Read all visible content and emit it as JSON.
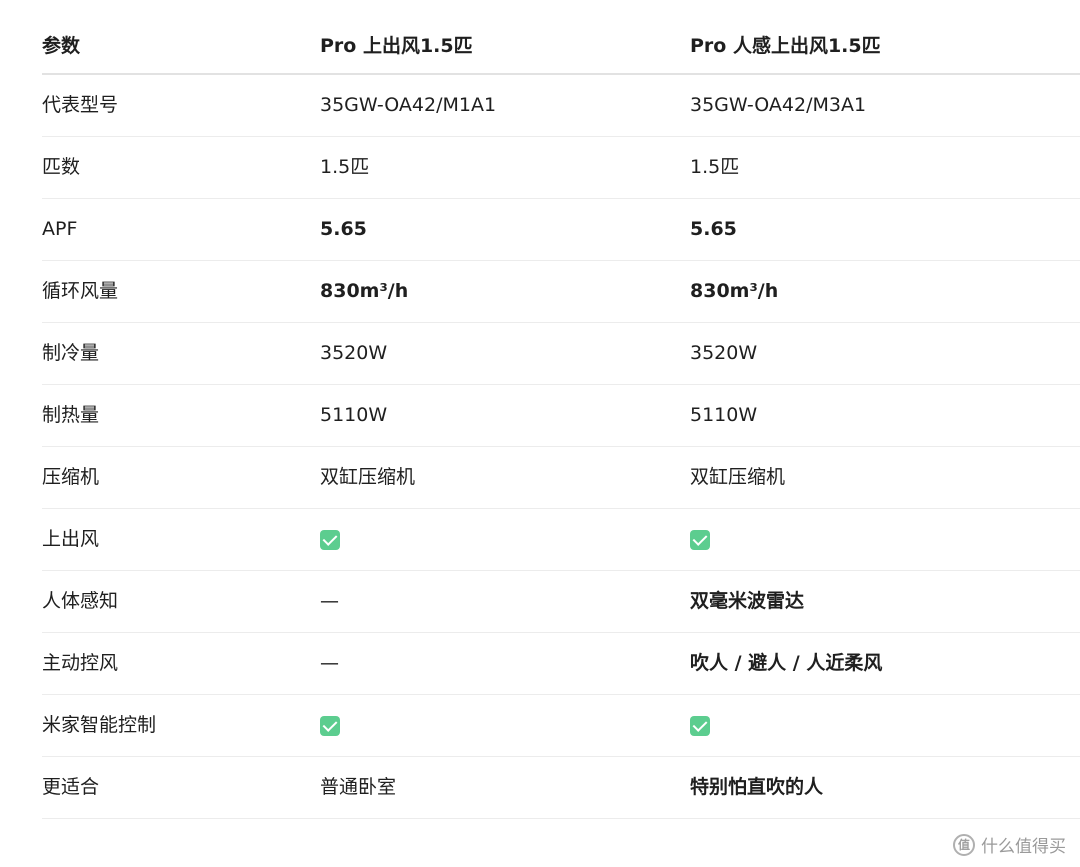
{
  "header": {
    "col1": "参数",
    "col2": "Pro 上出风1.5匹",
    "col3": "Pro 人感上出风1.5匹"
  },
  "rows": [
    {
      "label": "代表型号",
      "v1": "35GW-OA42/M1A1",
      "v2": "35GW-OA42/M3A1",
      "v1_bold": false,
      "v2_bold": false
    },
    {
      "label": "匹数",
      "v1": "1.5匹",
      "v2": "1.5匹",
      "v1_bold": false,
      "v2_bold": false
    },
    {
      "label": "APF",
      "v1": "5.65",
      "v2": "5.65",
      "v1_bold": true,
      "v2_bold": true
    },
    {
      "label": "循环风量",
      "v1": "830m³/h",
      "v2": "830m³/h",
      "v1_bold": true,
      "v2_bold": true
    },
    {
      "label": "制冷量",
      "v1": "3520W",
      "v2": "3520W",
      "v1_bold": false,
      "v2_bold": false
    },
    {
      "label": "制热量",
      "v1": "5110W",
      "v2": "5110W",
      "v1_bold": false,
      "v2_bold": false
    },
    {
      "label": "压缩机",
      "v1": "双缸压缩机",
      "v2": "双缸压缩机",
      "v1_bold": false,
      "v2_bold": false
    },
    {
      "label": "上出风",
      "v1": "check",
      "v2": "check",
      "v1_bold": false,
      "v2_bold": false
    },
    {
      "label": "人体感知",
      "v1": "—",
      "v2": "双毫米波雷达",
      "v1_bold": false,
      "v2_bold": true
    },
    {
      "label": "主动控风",
      "v1": "—",
      "v2": "吹人 / 避人 / 人近柔风",
      "v1_bold": false,
      "v2_bold": true
    },
    {
      "label": "米家智能控制",
      "v1": "check",
      "v2": "check",
      "v1_bold": false,
      "v2_bold": false
    },
    {
      "label": "更适合",
      "v1": "普通卧室",
      "v2": "特别怕直吹的人",
      "v1_bold": false,
      "v2_bold": true
    }
  ],
  "icons": {
    "check": "check-square-icon",
    "watermark": "zhidemai-logo-icon"
  },
  "colors": {
    "check_bg": "#5ccd8f",
    "divider": "#ececec",
    "watermark": "#9a9a9a"
  },
  "watermark": {
    "logo": "值",
    "text": "什么值得买"
  }
}
